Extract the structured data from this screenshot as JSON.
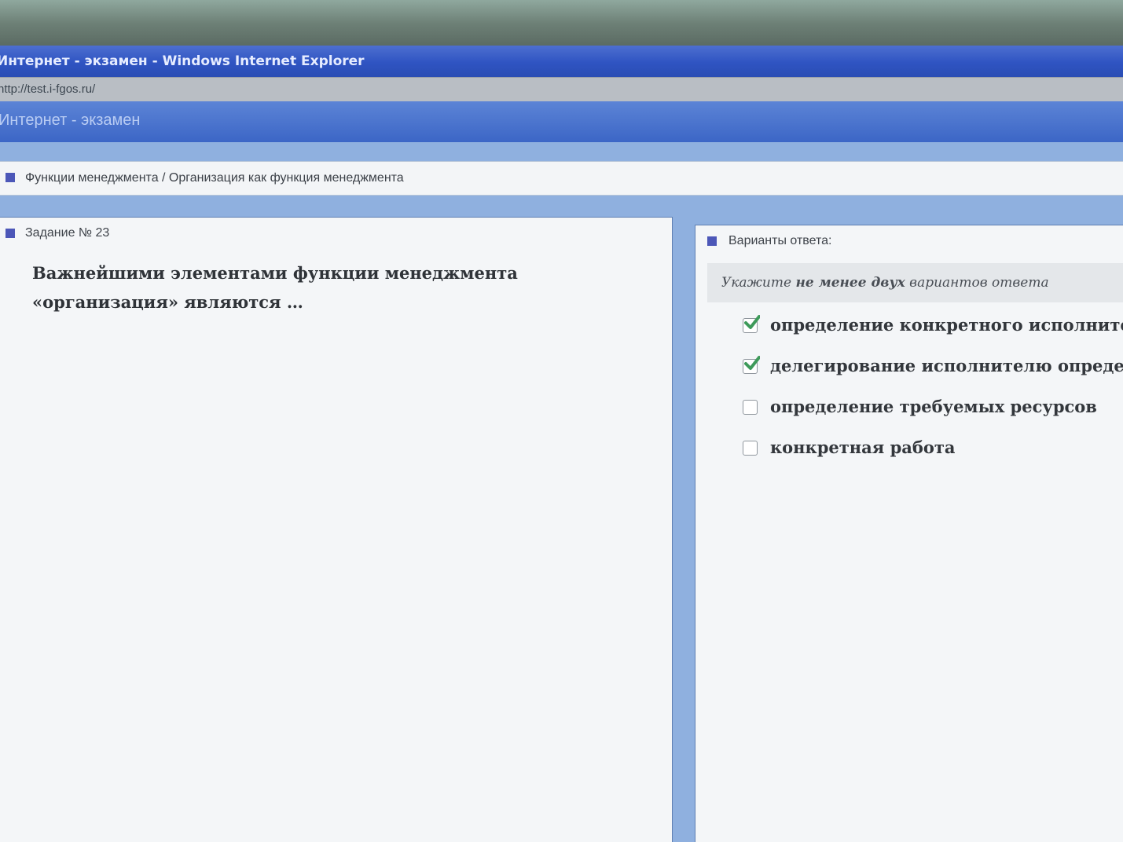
{
  "window": {
    "title": "Интернет - экзамен - Windows Internet Explorer",
    "address": "http://test.i-fgos.ru/",
    "tab_title": "Интернет - экзамен"
  },
  "breadcrumb": "Функции менеджмента / Организация как функция менеджмента",
  "task": {
    "header": "Задание № 23",
    "question": "Важнейшими элементами функции менеджмента «организация» являются …"
  },
  "answers": {
    "header": "Варианты ответа:",
    "instruction_prefix": "Укажите ",
    "instruction_bold": "не менее двух",
    "instruction_suffix": " вариантов ответа",
    "options": [
      {
        "label": "определение конкретного исполнителя",
        "checked": true
      },
      {
        "label": "делегирование исполнителю определен",
        "checked": true
      },
      {
        "label": "определение требуемых ресурсов",
        "checked": false
      },
      {
        "label": "конкретная работа",
        "checked": false
      }
    ]
  },
  "colors": {
    "accent": "#4c57b8",
    "check": "#3e9a5a"
  }
}
